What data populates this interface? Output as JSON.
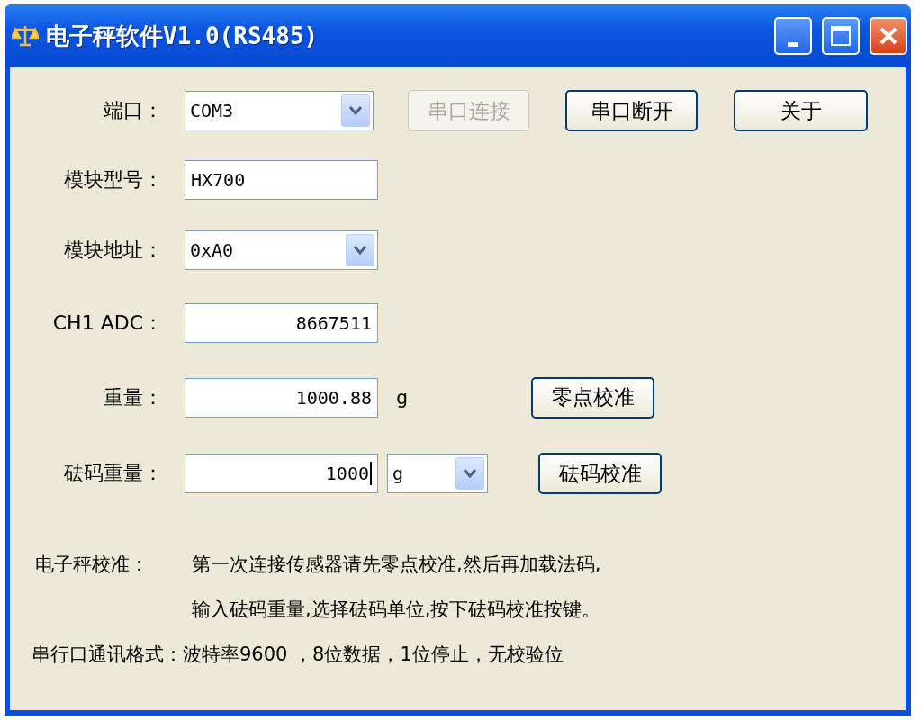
{
  "window": {
    "title": "电子秤软件V1.0(RS485)"
  },
  "rows": [
    {
      "label": "端口：",
      "field": {
        "kind": "combo",
        "value": "COM3"
      },
      "buttons": [
        {
          "label": "串口连接",
          "disabled": true
        },
        {
          "label": "串口断开",
          "disabled": false
        },
        {
          "label": "关于",
          "disabled": false
        }
      ]
    },
    {
      "label": "模块型号：",
      "field": {
        "kind": "text",
        "value": "HX700"
      }
    },
    {
      "label": "模块地址：",
      "field": {
        "kind": "combo",
        "value": "0xA0"
      }
    },
    {
      "label": "CH1 ADC：",
      "field": {
        "kind": "number",
        "value": "8667511"
      }
    },
    {
      "label": "重量：",
      "field": {
        "kind": "number",
        "value": "1000.88"
      },
      "unit": {
        "kind": "text",
        "value": "g"
      },
      "buttons": [
        {
          "label": "零点校准",
          "disabled": false
        }
      ]
    },
    {
      "label": "砝码重量：",
      "field": {
        "kind": "number",
        "value": "1000",
        "focused": true
      },
      "unit": {
        "kind": "combo",
        "value": "g"
      },
      "buttons": [
        {
          "label": "砝码校准",
          "disabled": false
        }
      ]
    }
  ],
  "calibration": {
    "label": "电子秤校准：",
    "lines": [
      "第一次连接传感器请先零点校准,然后再加载法码,",
      "输入砝码重量,选择砝码单位,按下砝码校准按键。"
    ]
  },
  "serial_format": "串行口通讯格式：波特率9600 ，8位数据，1位停止，无校验位"
}
